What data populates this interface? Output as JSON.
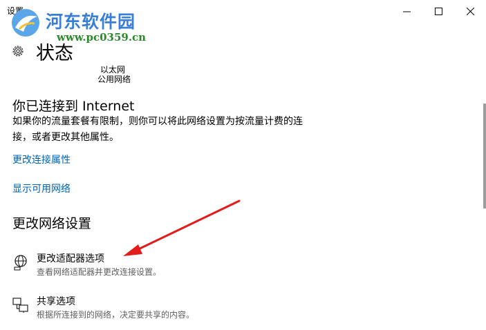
{
  "window": {
    "title": "设置",
    "controls": {
      "minimize": "minimize",
      "maximize": "maximize",
      "close": "close"
    }
  },
  "watermark": {
    "name": "河东软件园",
    "url": "www.pc0359.cn"
  },
  "header": {
    "title": "状态",
    "icon": "gear-icon"
  },
  "network": {
    "type": "以太网",
    "profile": "公用网络"
  },
  "connection": {
    "heading": "你已连接到 Internet",
    "description": "如果你的流量套餐有限制，则你可以将此网络设置为按流量计费的连接，或者更改其他属性。"
  },
  "links": {
    "change_properties": "更改连接属性",
    "show_networks": "显示可用网络"
  },
  "section": {
    "heading": "更改网络设置",
    "options": [
      {
        "title": "更改适配器选项",
        "desc": "查看网络适配器并更改连接设置。",
        "icon": "network-adapter-icon"
      },
      {
        "title": "共享选项",
        "desc": "根据所连接到的网络，决定要共享的内容。",
        "icon": "sharing-icon"
      }
    ]
  },
  "colors": {
    "link": "#0063b1",
    "annotation_arrow": "#e21b1b",
    "watermark_blue": "#3a7fd5",
    "watermark_green": "#2a8a2a"
  }
}
